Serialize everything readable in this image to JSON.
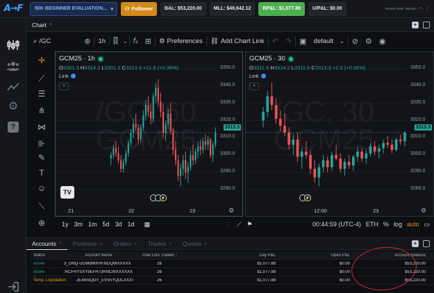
{
  "topbar": {
    "logo": "A→F",
    "account_select": "50K BEGINNER EVALUATION...",
    "follower_label": "Follower",
    "bal": "BAL: $53,220.00",
    "mll": "MLL: $49,642.12",
    "rpl": "RP&L: $1,077.88",
    "upl": "U/P&L: $0.00",
    "refresh": "Refresh Rate: Medium"
  },
  "sidebar": {
    "items": [
      "chart-icon",
      "users-icon",
      "analytics-icon",
      "settings-icon",
      "help-icon",
      "logout-icon"
    ]
  },
  "chart_tab": {
    "label": "Chart"
  },
  "toolbar": {
    "symbol": "/GC",
    "interval": "1h",
    "preferences": "Preferences",
    "add_chart_link": "Add Chart Link",
    "layout": "default"
  },
  "pane_left": {
    "title": "GCM25 · 1h",
    "ohlc": {
      "o": "3301.3",
      "h": "3314.2",
      "l": "3301.2",
      "c": "3313.3",
      "chg": "+11.9 (+0.36%)"
    },
    "link": "Link",
    "watermark1": "/GC, 60",
    "watermark2": "GCM25",
    "price_labels": [
      "3350.0",
      "3340.0",
      "3330.0",
      "3320.0",
      "3310.0",
      "3300.0",
      "3290.0",
      "3280.0"
    ],
    "last_price": "3313.3",
    "time_labels": [
      "21",
      "22",
      "23"
    ]
  },
  "pane_right": {
    "title": "GCM25 · 30",
    "ohlc": {
      "o": "3311.5",
      "h": "3314.2",
      "l": "3311.5",
      "c": "3313.3",
      "chg": "+2.0 (+0.06%)"
    },
    "link": "Link",
    "watermark1": "/GC, 30",
    "watermark2": "GCM25",
    "price_labels": [
      "3350.0",
      "3340.0",
      "3330.0",
      "3320.0",
      "3310.0",
      "3300.0",
      "3290.0",
      "3280.0"
    ],
    "last_price": "3313.3",
    "time_labels": [
      "12:00",
      "23"
    ]
  },
  "range_bar": {
    "ranges": [
      "1y",
      "3m",
      "1m",
      "5d",
      "3d",
      "1d"
    ],
    "clock": "00:44:59 (UTC-4)",
    "session": "ETH",
    "pct": "%",
    "log": "log",
    "auto": "auto"
  },
  "accounts": {
    "tabs": [
      "Accounts",
      "Positions",
      "Orders",
      "Trades",
      "Quotes"
    ],
    "headers": [
      "Status",
      "Account Name",
      "Total Lots Traded",
      "Day P&L",
      "Open P&L",
      "Account Balance"
    ],
    "rows": [
      {
        "status": "Active",
        "name": "3_ONQ-UGMBMXHFNOQWXXXXX",
        "lots": "26",
        "day": "$1,077.88",
        "open": "$0.00",
        "balance": "$53,220.00"
      },
      {
        "status": "Active",
        "name": ":RCFRYSXY9EFH73RNCWXXXXXX",
        "lots": "26",
        "day": "$1,077.88",
        "open": "$0.00",
        "balance": "$53,220.00"
      },
      {
        "status": "Temp. Liquidation",
        "name": "JEAKNQGY_EVS5YQDLXXXXXXXX",
        "lots": "26",
        "day": "$1,077.88",
        "open": "$0.00",
        "balance": "$53,220.00"
      }
    ]
  },
  "chart_data": [
    {
      "type": "candlestick",
      "title": "GCM25 · 1h",
      "ylim": [
        3276,
        3354
      ],
      "x_ticks": [
        "21",
        "22",
        "23"
      ],
      "candles": [
        [
          3298,
          3302,
          3294,
          3300
        ],
        [
          3300,
          3306,
          3298,
          3304
        ],
        [
          3304,
          3308,
          3299,
          3301
        ],
        [
          3301,
          3305,
          3295,
          3297
        ],
        [
          3297,
          3300,
          3290,
          3292
        ],
        [
          3292,
          3298,
          3290,
          3296
        ],
        [
          3296,
          3303,
          3294,
          3301
        ],
        [
          3301,
          3309,
          3299,
          3307
        ],
        [
          3307,
          3315,
          3305,
          3313
        ],
        [
          3313,
          3321,
          3310,
          3318
        ],
        [
          3318,
          3324,
          3314,
          3316
        ],
        [
          3316,
          3318,
          3306,
          3309
        ],
        [
          3309,
          3318,
          3307,
          3316
        ],
        [
          3316,
          3326,
          3314,
          3323
        ],
        [
          3323,
          3332,
          3320,
          3329
        ],
        [
          3329,
          3334,
          3322,
          3325
        ],
        [
          3325,
          3330,
          3318,
          3321
        ],
        [
          3321,
          3336,
          3319,
          3334
        ],
        [
          3334,
          3342,
          3330,
          3339
        ],
        [
          3339,
          3344,
          3328,
          3331
        ],
        [
          3331,
          3336,
          3322,
          3325
        ],
        [
          3325,
          3330,
          3310,
          3313
        ],
        [
          3313,
          3320,
          3308,
          3318
        ],
        [
          3318,
          3327,
          3315,
          3324
        ],
        [
          3324,
          3330,
          3312,
          3314
        ],
        [
          3314,
          3316,
          3300,
          3303
        ],
        [
          3303,
          3308,
          3294,
          3297
        ],
        [
          3297,
          3300,
          3285,
          3288
        ],
        [
          3288,
          3295,
          3282,
          3292
        ],
        [
          3292,
          3300,
          3288,
          3297
        ],
        [
          3297,
          3302,
          3286,
          3290
        ],
        [
          3290,
          3296,
          3284,
          3293
        ],
        [
          3293,
          3303,
          3291,
          3300
        ],
        [
          3300,
          3306,
          3294,
          3297
        ],
        [
          3297,
          3304,
          3295,
          3302
        ],
        [
          3302,
          3308,
          3298,
          3305
        ],
        [
          3305,
          3309,
          3300,
          3303
        ],
        [
          3303,
          3310,
          3301,
          3308
        ],
        [
          3308,
          3312,
          3303,
          3306
        ],
        [
          3306,
          3311,
          3303,
          3309
        ],
        [
          3309,
          3310,
          3298,
          3300
        ],
        [
          3300,
          3308,
          3296,
          3306
        ],
        [
          3306,
          3316,
          3304,
          3313
        ]
      ]
    },
    {
      "type": "candlestick",
      "title": "GCM25 · 30",
      "ylim": [
        3276,
        3354
      ],
      "x_ticks": [
        "12:00",
        "23"
      ],
      "candles": [
        [
          3320,
          3328,
          3316,
          3325
        ],
        [
          3325,
          3337,
          3322,
          3334
        ],
        [
          3334,
          3342,
          3326,
          3329
        ],
        [
          3329,
          3333,
          3318,
          3321
        ],
        [
          3321,
          3326,
          3314,
          3317
        ],
        [
          3317,
          3324,
          3311,
          3313
        ],
        [
          3313,
          3316,
          3303,
          3306
        ],
        [
          3306,
          3312,
          3300,
          3309
        ],
        [
          3309,
          3313,
          3296,
          3299
        ],
        [
          3299,
          3304,
          3292,
          3302
        ],
        [
          3302,
          3308,
          3298,
          3300
        ],
        [
          3300,
          3303,
          3289,
          3292
        ],
        [
          3292,
          3297,
          3284,
          3287
        ],
        [
          3287,
          3295,
          3282,
          3293
        ],
        [
          3293,
          3300,
          3290,
          3297
        ],
        [
          3297,
          3299,
          3290,
          3293
        ],
        [
          3293,
          3302,
          3291,
          3300
        ],
        [
          3300,
          3306,
          3297,
          3298
        ],
        [
          3298,
          3301,
          3290,
          3292
        ],
        [
          3292,
          3298,
          3288,
          3296
        ],
        [
          3296,
          3300,
          3292,
          3294
        ],
        [
          3294,
          3300,
          3291,
          3299
        ],
        [
          3299,
          3305,
          3296,
          3302
        ],
        [
          3302,
          3304,
          3296,
          3298
        ],
        [
          3298,
          3303,
          3295,
          3301
        ],
        [
          3301,
          3307,
          3299,
          3305
        ],
        [
          3305,
          3308,
          3300,
          3302
        ],
        [
          3302,
          3306,
          3298,
          3304
        ],
        [
          3304,
          3309,
          3301,
          3307
        ],
        [
          3307,
          3311,
          3304,
          3306
        ],
        [
          3306,
          3309,
          3301,
          3303
        ],
        [
          3303,
          3310,
          3302,
          3309
        ],
        [
          3309,
          3312,
          3306,
          3308
        ],
        [
          3308,
          3314,
          3305,
          3313
        ]
      ]
    }
  ],
  "colors": {
    "up": "#26a69a",
    "down": "#ef5350",
    "accent": "#3f8cff",
    "follower": "#d38a1a"
  }
}
